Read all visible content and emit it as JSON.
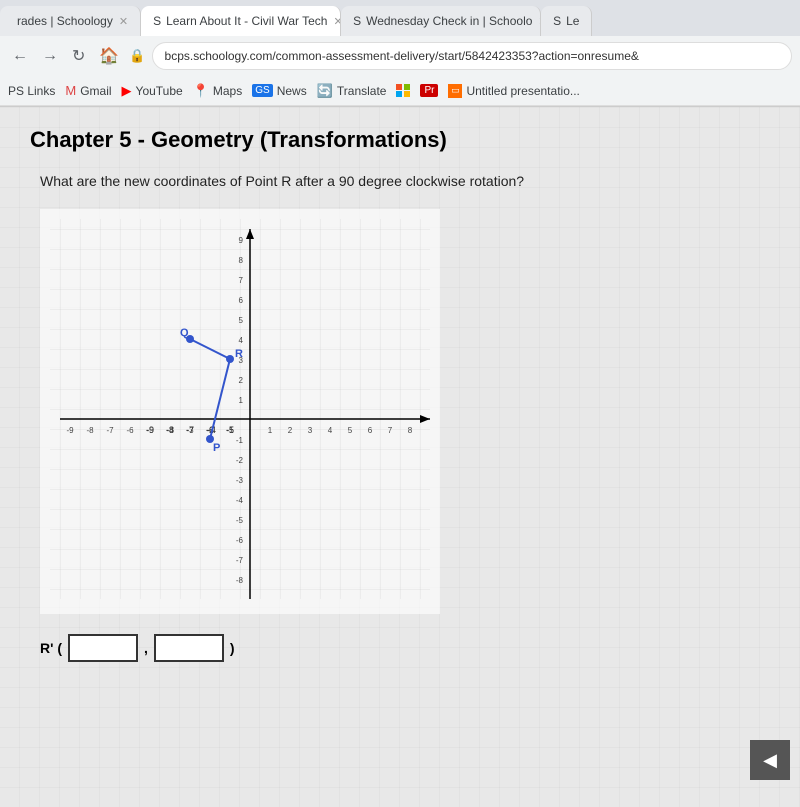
{
  "browser": {
    "tabs": [
      {
        "id": "tab1",
        "label": "rades | Schoology",
        "favicon": "",
        "active": false
      },
      {
        "id": "tab2",
        "label": "Learn About It - Civil War Tech",
        "favicon": "S",
        "active": true
      },
      {
        "id": "tab3",
        "label": "Wednesday Check in | Schoolo",
        "favicon": "S",
        "active": false
      },
      {
        "id": "tab4",
        "label": "Le",
        "favicon": "S",
        "active": false
      }
    ],
    "address": "bcps.schoology.com/common-assessment-delivery/start/5842423353?action=onresume&",
    "bookmarks": [
      {
        "label": "PS Links",
        "icon": ""
      },
      {
        "label": "Gmail",
        "icon": "M"
      },
      {
        "label": "YouTube",
        "icon": "▶"
      },
      {
        "label": "Maps",
        "icon": "📍"
      },
      {
        "label": "News",
        "icon": "GS"
      },
      {
        "label": "Translate",
        "icon": "🔄"
      },
      {
        "label": "...",
        "icon": ""
      },
      {
        "label": "Pr",
        "icon": ""
      },
      {
        "label": "Untitled presentatio...",
        "icon": ""
      }
    ]
  },
  "page": {
    "chapter_title": "Chapter 5 - Geometry (Transformations)",
    "question_text": "What are the new coordinates of Point R after a 90 degree clockwise rotation?",
    "answer_label": "R' (",
    "answer_separator": ",",
    "answer_close": ")",
    "nav_arrow": "◀"
  }
}
